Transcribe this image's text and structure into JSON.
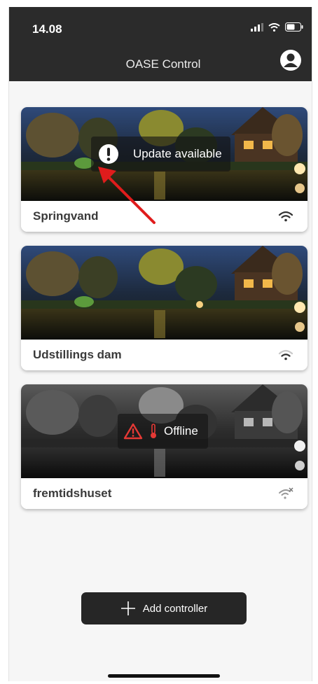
{
  "status_bar": {
    "time": "14.08"
  },
  "header": {
    "title": "OASE Control"
  },
  "controllers": [
    {
      "name": "Springvand",
      "overlay": "Update available",
      "wifi": "connected"
    },
    {
      "name": "Udstillings dam",
      "overlay": "",
      "wifi": "connected-dim"
    },
    {
      "name": "fremtidshuset",
      "overlay": "Offline",
      "wifi": "disconnected"
    }
  ],
  "add_button": {
    "label": "Add controller",
    "icon": "plus-icon"
  },
  "colors": {
    "header_bg": "#2b2b2b",
    "arrow": "#e01c1c",
    "warning": "#e53935",
    "button_bg": "#262626"
  },
  "icons": [
    "signal-icon",
    "wifi-icon",
    "battery-icon",
    "account-icon",
    "alert-icon",
    "warning-icon",
    "temperature-icon",
    "wifi-off-icon"
  ]
}
